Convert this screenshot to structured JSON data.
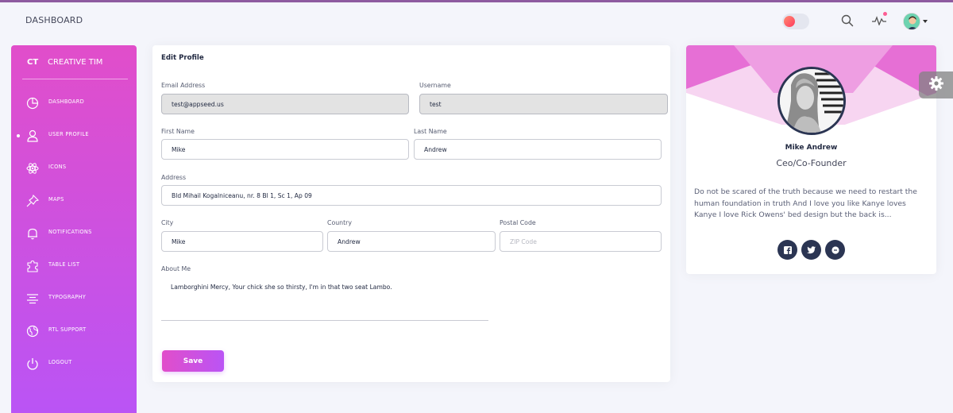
{
  "navbar": {
    "title": "DASHBOARD",
    "icons": {
      "theme_toggle": "theme-toggle",
      "search": "search-icon",
      "activity": "activity-icon",
      "avatar": "avatar"
    }
  },
  "sidebar": {
    "logo_mini": "CT",
    "logo_text": "CREATIVE TIM",
    "items": [
      {
        "label": "DASHBOARD",
        "icon": "chart-pie-icon"
      },
      {
        "label": "USER PROFILE",
        "icon": "user-icon",
        "active": true
      },
      {
        "label": "ICONS",
        "icon": "atom-icon"
      },
      {
        "label": "MAPS",
        "icon": "pin-icon"
      },
      {
        "label": "NOTIFICATIONS",
        "icon": "bell-icon"
      },
      {
        "label": "TABLE LIST",
        "icon": "puzzle-icon"
      },
      {
        "label": "TYPOGRAPHY",
        "icon": "align-center-icon"
      },
      {
        "label": "RTL SUPPORT",
        "icon": "world-icon"
      },
      {
        "label": "LOGOUT",
        "icon": "power-icon"
      }
    ]
  },
  "edit_profile": {
    "title": "Edit Profile",
    "email_label": "Email Address",
    "email_value": "test@appseed.us",
    "username_label": "Username",
    "username_value": "test",
    "first_name_label": "First Name",
    "first_name_value": "Mike",
    "last_name_label": "Last Name",
    "last_name_value": "Andrew",
    "address_label": "Address",
    "address_value": "Bld Mihail Kogalniceanu, nr. 8 Bl 1, Sc 1, Ap 09",
    "city_label": "City",
    "city_value": "Mike",
    "country_label": "Country",
    "country_value": "Andrew",
    "postal_label": "Postal Code",
    "postal_placeholder": "ZIP Code",
    "about_label": "About Me",
    "about_value": "Lamborghini Mercy, Your chick she so thirsty, I'm in that two seat Lambo.",
    "save_label": "Save"
  },
  "profile_card": {
    "name": "Mike Andrew",
    "role": "Ceo/Co-Founder",
    "bio": "Do not be scared of the truth because we need to restart the human foundation in truth And I love you like Kanye loves Kanye I love Rick Owens' bed design but the back is...",
    "social": [
      "facebook-icon",
      "twitter-icon",
      "google-icon"
    ]
  },
  "colors": {
    "primary_gradient_start": "#e14eca",
    "primary_gradient_end": "#ba54f5",
    "dark_blue": "#2b3553",
    "background": "#f4f5fb"
  }
}
